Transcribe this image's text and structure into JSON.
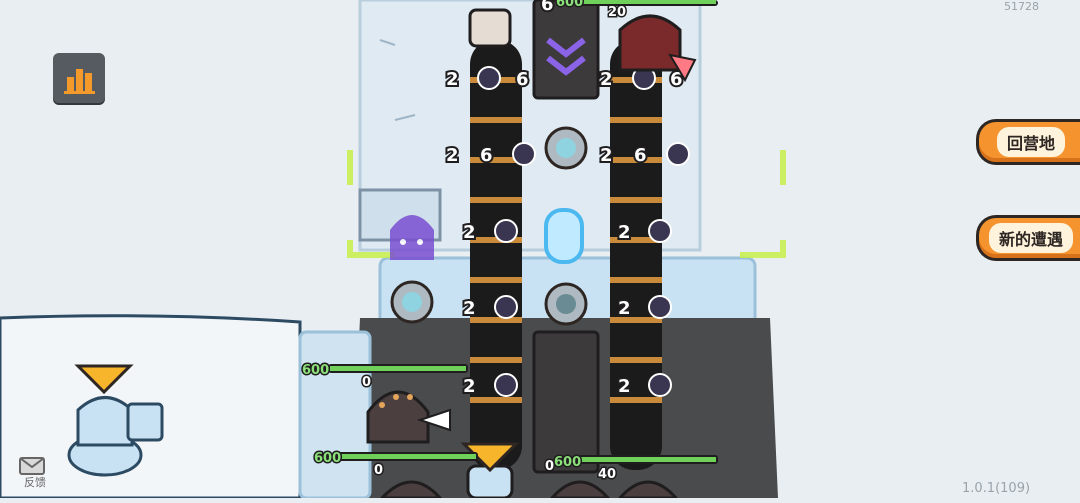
{
  "hud": {
    "score": "51728",
    "version": "1.0.1(109)"
  },
  "side_buttons": {
    "return_camp": "回营地",
    "new_encounter": "新的遭遇"
  },
  "feedback": {
    "label": "反馈"
  },
  "units": [
    {
      "hp": "600",
      "shield": "0"
    },
    {
      "hp": "600",
      "shield": "0"
    },
    {
      "hp": "600",
      "shield": "0"
    },
    {
      "hp": "600",
      "shield": "20"
    },
    {
      "hp": "600",
      "shield": "40"
    }
  ],
  "top_label": "6",
  "chain_rows": [
    {
      "left": [
        "2",
        "6"
      ],
      "right": [
        "2",
        "6"
      ]
    },
    {
      "left": [
        "2",
        "6"
      ],
      "right": [
        "2",
        "6"
      ]
    },
    {
      "left": [
        "2"
      ],
      "right": [
        "2"
      ]
    },
    {
      "left": [
        "2"
      ],
      "right": [
        "2"
      ]
    },
    {
      "left": [
        "2"
      ],
      "right": [
        "2"
      ]
    }
  ],
  "colors": {
    "snow": "#e9eef2",
    "ice": "#c9e2f3",
    "rock": "#4a4b4d",
    "hp_green": "#6fd15a",
    "orange": "#f5932e",
    "purple": "#7a4fd1",
    "highlight": "#c8f04a"
  },
  "icons": [
    "stats-icon",
    "igloo-icon",
    "feedback-icon",
    "fist-icon",
    "ghost-icon",
    "sad-face-icon",
    "chevron-icon"
  ]
}
